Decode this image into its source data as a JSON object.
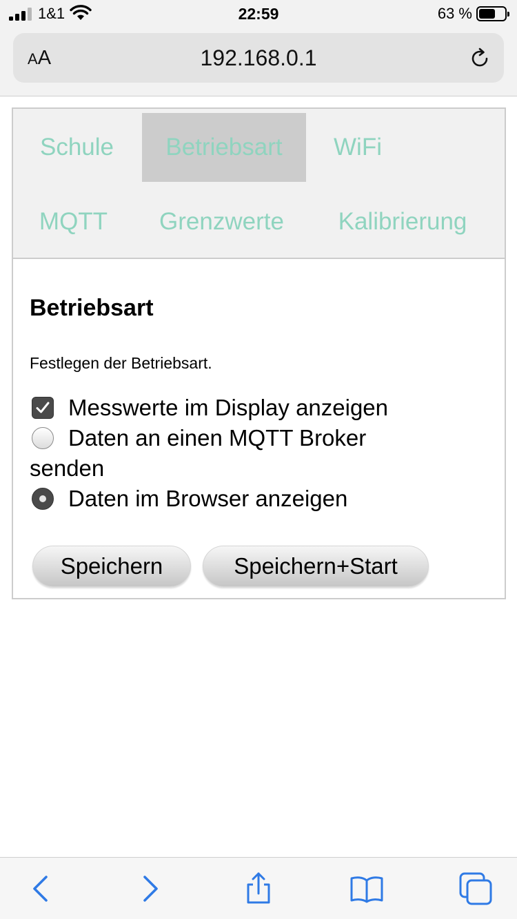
{
  "status_bar": {
    "carrier": "1&1",
    "time": "22:59",
    "battery_percent": "63 %",
    "battery_level": 0.63,
    "signal_bars": 3
  },
  "browser": {
    "text_size_label_small": "A",
    "text_size_label_large": "A",
    "url": "192.168.0.1"
  },
  "tabs": [
    {
      "label": "Schule",
      "active": false
    },
    {
      "label": "Betriebsart",
      "active": true
    },
    {
      "label": "WiFi",
      "active": false
    },
    {
      "label": "MQTT",
      "active": false
    },
    {
      "label": "Grenzwerte",
      "active": false
    },
    {
      "label": "Kalibrierung",
      "active": false
    }
  ],
  "panel": {
    "title": "Betriebsart",
    "description": "Festlegen der Betriebsart.",
    "options": [
      {
        "type": "checkbox",
        "label": "Messwerte im Display anzeigen",
        "checked": true
      },
      {
        "type": "radio",
        "label": "Daten an einen MQTT Broker senden",
        "checked": false
      },
      {
        "type": "radio",
        "label": "Daten im Browser anzeigen",
        "checked": true
      }
    ],
    "buttons": {
      "save": "Speichern",
      "save_start": "Speichern+Start"
    }
  },
  "colors": {
    "tab_text": "#8fd4bf",
    "tab_active_bg": "#cccccc",
    "tabs_bg": "#f1f1f1",
    "toolbar_icon": "#2f7ae5"
  },
  "toolbar": {
    "icons": [
      "back-icon",
      "forward-icon",
      "share-icon",
      "bookmarks-icon",
      "tabs-icon"
    ]
  }
}
